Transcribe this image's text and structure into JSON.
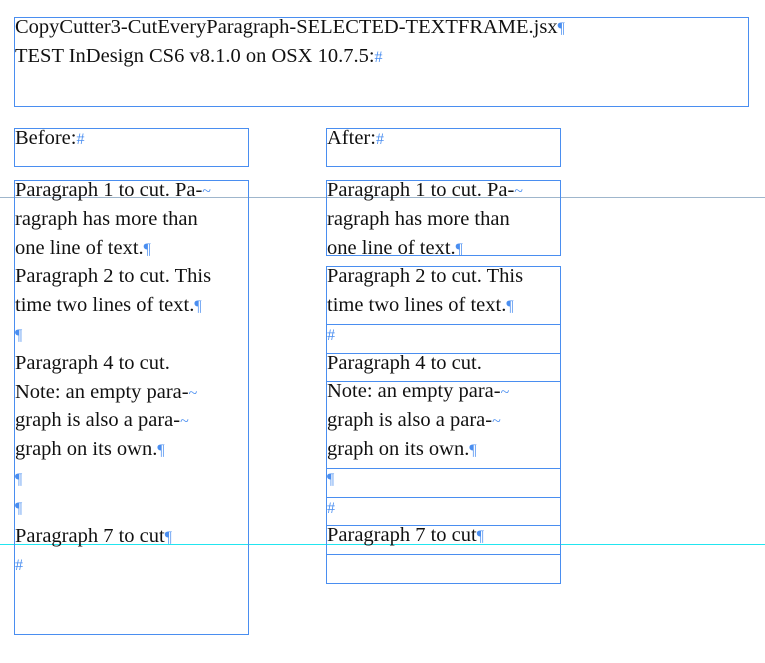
{
  "header": {
    "lines": [
      {
        "text": "CopyCutter3-CutEveryParagraph-SELECTED-TEXTFRAME.jsx",
        "mark": "¶"
      },
      {
        "text": "TEST InDesign CS6 v8.1.0 on OSX 10.7.5:",
        "mark": "#"
      }
    ]
  },
  "before_label": {
    "text": "Before:",
    "mark": "#"
  },
  "after_label": {
    "text": "After:",
    "mark": "#"
  },
  "before_text": [
    {
      "text": "Paragraph 1 to cut. Pa-",
      "mark": "~"
    },
    {
      "text": "ragraph has more than",
      "mark": ""
    },
    {
      "text": "one line of text.",
      "mark": "¶"
    },
    {
      "text": "Paragraph 2 to cut. This",
      "mark": ""
    },
    {
      "text": "time two lines of text.",
      "mark": "¶"
    },
    {
      "text": "",
      "mark": "¶"
    },
    {
      "text": "Paragraph 4 to cut.",
      "mark": ""
    },
    {
      "text": "Note: an empty para-",
      "mark": "~"
    },
    {
      "text": "graph is also a para-",
      "mark": "~"
    },
    {
      "text": "graph on its own.",
      "mark": "¶"
    },
    {
      "text": "",
      "mark": "¶"
    },
    {
      "text": "",
      "mark": "¶"
    },
    {
      "text": "Paragraph 7 to cut",
      "mark": "¶"
    },
    {
      "text": "",
      "mark": "#"
    }
  ],
  "after_frames": [
    [
      {
        "text": "Paragraph 1 to cut. Pa-",
        "mark": "~"
      },
      {
        "text": "ragraph has more than",
        "mark": ""
      },
      {
        "text": "one line of text.",
        "mark": "¶"
      }
    ],
    [
      {
        "text": "Paragraph 2 to cut. This",
        "mark": ""
      },
      {
        "text": "time two lines of text.",
        "mark": "¶"
      }
    ],
    [
      {
        "text": "",
        "mark": "#"
      }
    ],
    [
      {
        "text": "Paragraph 4 to cut.",
        "mark": ""
      }
    ],
    [
      {
        "text": "Note: an empty para-",
        "mark": "~"
      },
      {
        "text": "graph is also a para-",
        "mark": "~"
      },
      {
        "text": "graph on its own.",
        "mark": "¶"
      }
    ],
    [
      {
        "text": "",
        "mark": "¶"
      }
    ],
    [
      {
        "text": "",
        "mark": "#"
      }
    ],
    [
      {
        "text": "Paragraph 7 to cut",
        "mark": "¶"
      }
    ],
    [
      {
        "text": "",
        "mark": ""
      }
    ]
  ]
}
